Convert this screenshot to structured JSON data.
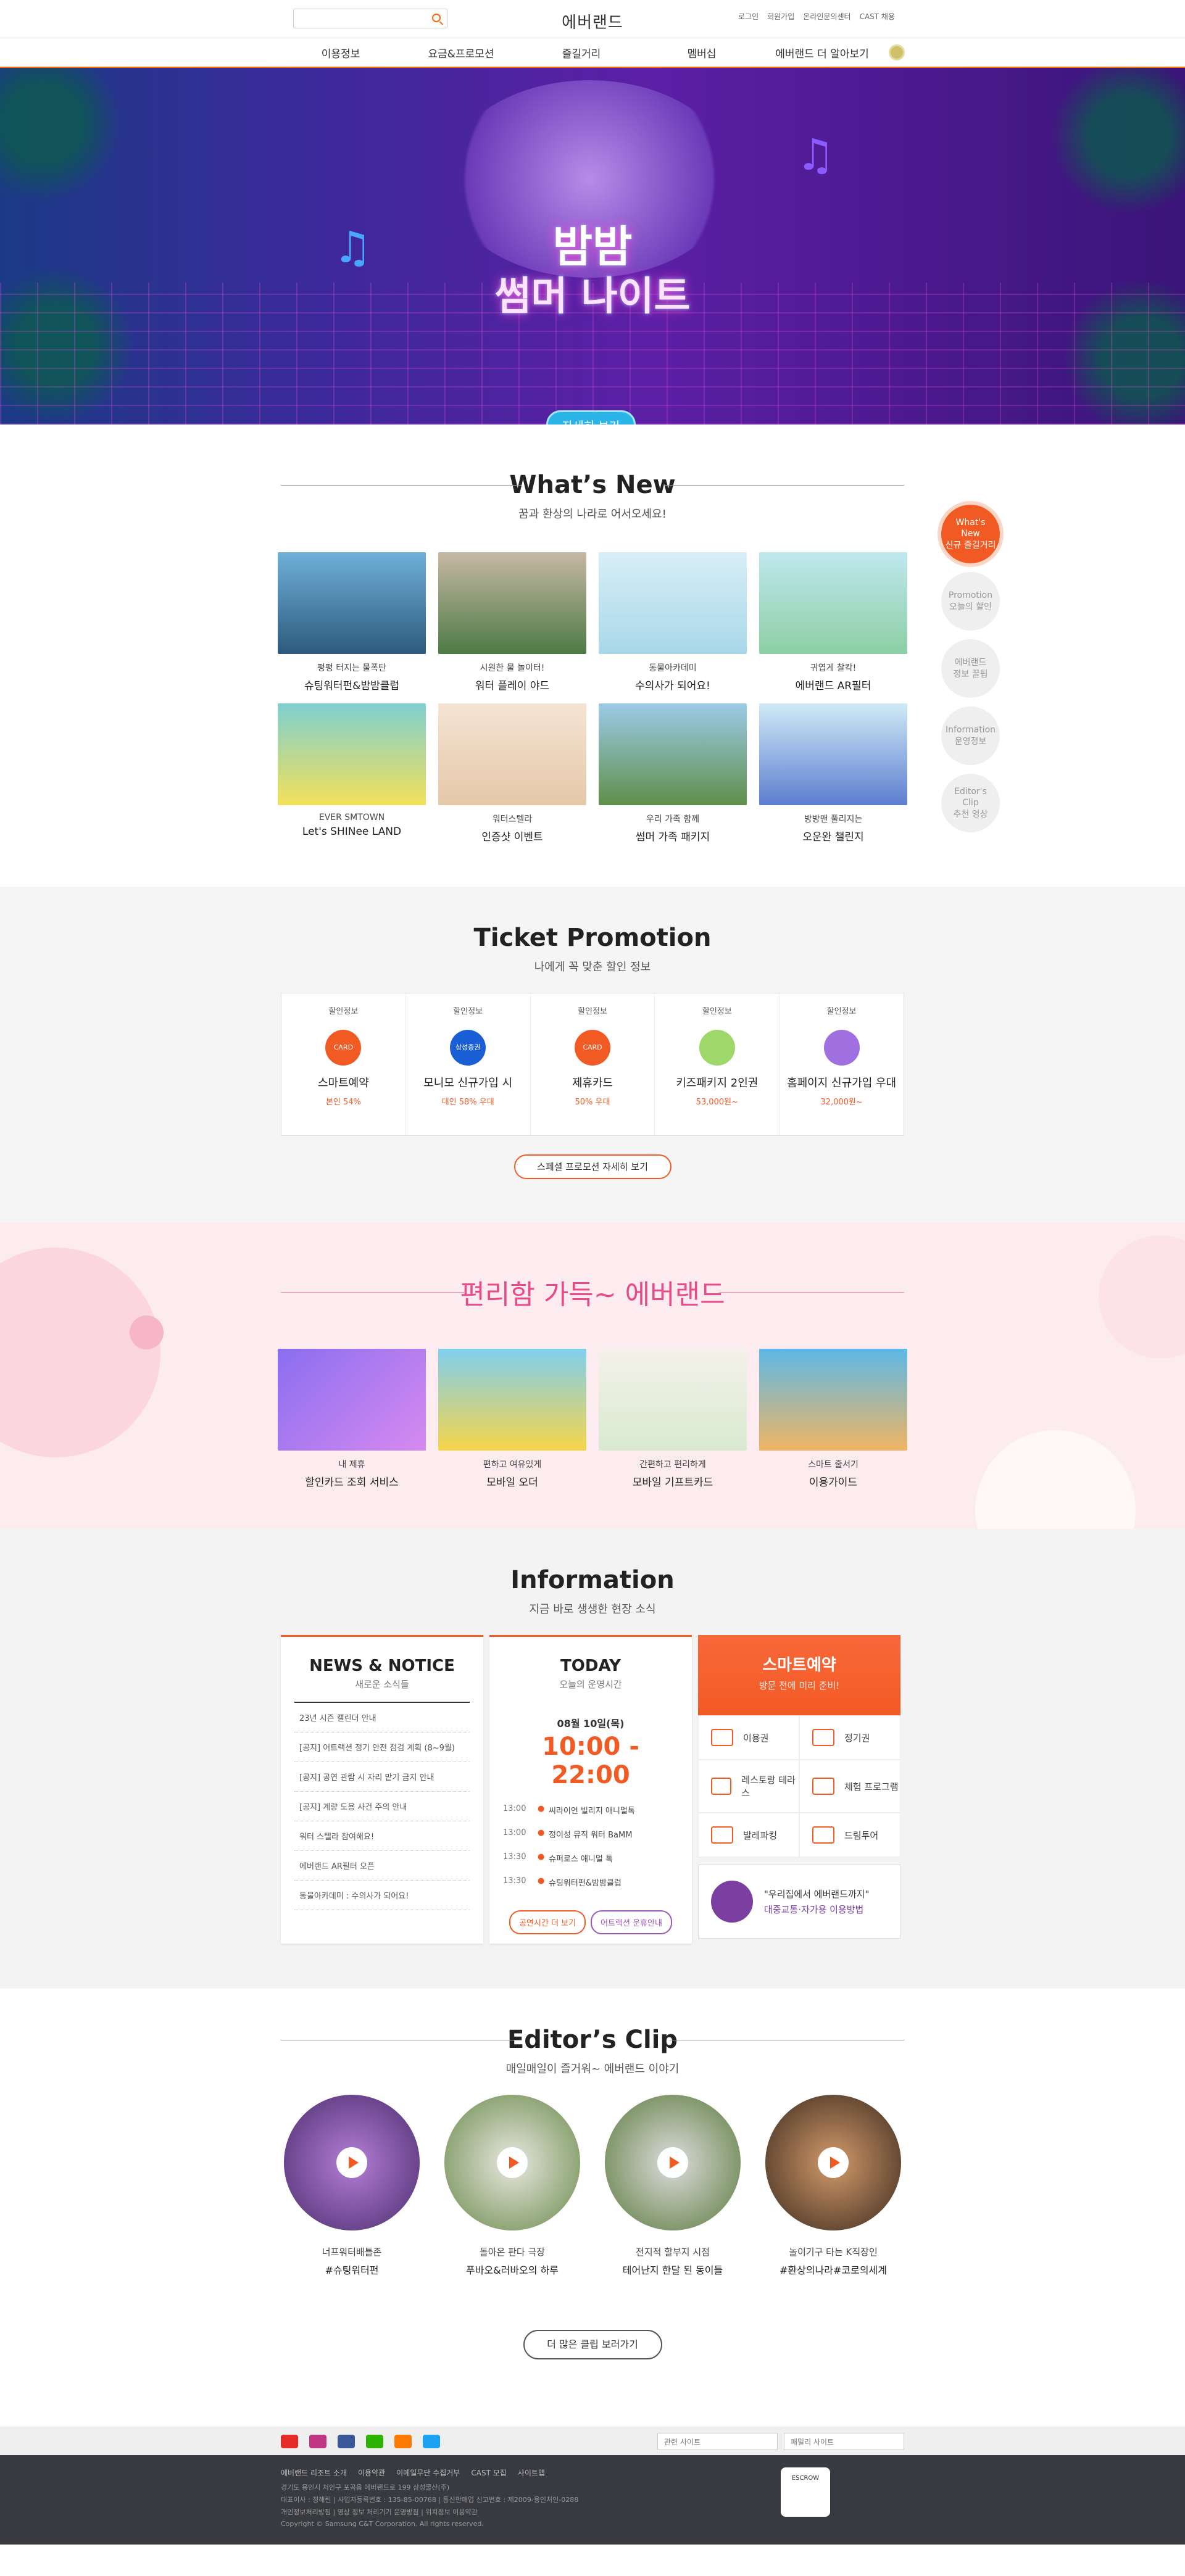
{
  "header": {
    "logo": "에버랜드",
    "search_placeholder": "",
    "links": [
      "로그인",
      "회원가입",
      "온라인문의센터",
      "CAST 채용"
    ]
  },
  "gnb": [
    "이용정보",
    "요금&프로모션",
    "즐길거리",
    "멤버십",
    "에버랜드 더 알아보기"
  ],
  "hero": {
    "title": "밤밤",
    "subtitle": "썸머 나이트",
    "button": "자세히 보기",
    "dots": 7,
    "active_dot": 6
  },
  "whatsnew": {
    "title": "What’s New",
    "sub": "꿈과 환상의 나라로 어서오세요!",
    "cards": [
      {
        "c1": "펑펑 터지는 물폭탄",
        "c2": "슈팅워터펀&밤밤클럽"
      },
      {
        "c1": "시원한 물 놀이터!",
        "c2": "워터 플레이 야드"
      },
      {
        "c1": "동물아카데미",
        "c2": "수의사가 되어요!"
      },
      {
        "c1": "귀엽게 찰칵!",
        "c2": "에버랜드 AR필터"
      },
      {
        "c1": "EVER SMTOWN",
        "c2": "Let's SHINee LAND"
      },
      {
        "c1": "워터스텔라",
        "c2": "인증샷 이벤트"
      },
      {
        "c1": "우리 가족 함께",
        "c2": "썸머 가족 패키지"
      },
      {
        "c1": "방방맨 풀리지는",
        "c2": "오운완 챌린지"
      }
    ]
  },
  "side": [
    {
      "l1": "What's",
      "l2": "New",
      "l3": "신규 즐길거리"
    },
    {
      "l1": "Promotion",
      "l2": "오늘의 할인",
      "l3": ""
    },
    {
      "l1": "에버랜드",
      "l2": "정보 꿀팁",
      "l3": ""
    },
    {
      "l1": "Information",
      "l2": "운영정보",
      "l3": ""
    },
    {
      "l1": "Editor's",
      "l2": "Clip",
      "l3": "추천 영상"
    }
  ],
  "ticket": {
    "title": "Ticket Promotion",
    "sub": "나에게 꼭 맞춘 할인 정보",
    "label": "할인정보",
    "items": [
      {
        "icon": "CARD",
        "name": "스마트예약",
        "price": "본인 54%"
      },
      {
        "icon": "삼성증권",
        "name": "모니모 신규가입 시",
        "price": "대인 58% 우대"
      },
      {
        "icon": "CARD",
        "name": "제휴카드",
        "price": "50% 우대"
      },
      {
        "icon": "",
        "name": "키즈패키지 2인권",
        "price": "53,000원~"
      },
      {
        "icon": "",
        "name": "홈페이지 신규가입 우대",
        "price": "32,000원~"
      }
    ],
    "button": "스페셜 프로모션 자세히 보기"
  },
  "conv": {
    "title": "편리함 가득~ 에버랜드",
    "cards": [
      {
        "c1": "내 제휴",
        "c2": "할인카드 조회 서비스"
      },
      {
        "c1": "편하고 여유있게",
        "c2": "모바일 오더"
      },
      {
        "c1": "간편하고 편리하게",
        "c2": "모바일 기프트카드"
      },
      {
        "c1": "스마트 줄서기",
        "c2": "이용가이드"
      }
    ]
  },
  "info": {
    "title": "Information",
    "sub": "지금 바로 생생한 현장 소식",
    "news": {
      "title": "NEWS & NOTICE",
      "sub": "새로운 소식들",
      "items": [
        "23년 시즌 캘린더 안내",
        "[공지] 어트랙션 정기 안전 점검 계획 (8~9월)",
        "[공지] 공연 관람 시 자리 맡기 금지 안내",
        "[공지] 계량 도용 사건 주의 안내",
        "워터 스텔라 참여해요!",
        "에버랜드 AR필터 오픈",
        "동물아카데미 : 수의사가 되어요!"
      ]
    },
    "today": {
      "title": "TODAY",
      "sub": "오늘의 운영시간",
      "date": "08월 10일(목)",
      "time": "10:00 - 22:00",
      "schedule": [
        {
          "t": "13:00",
          "d": "씨라이언 빌리지 애니멀톡"
        },
        {
          "t": "13:00",
          "d": "정이성 뮤직 워터 BaMM"
        },
        {
          "t": "13:30",
          "d": "슈퍼로스 애니멀 톡"
        },
        {
          "t": "13:30",
          "d": "슈팅워터펀&밤밤클럽"
        }
      ],
      "btn1": "공연시간 더 보기",
      "btn2": "어트랙션 운휴안내"
    },
    "smart": {
      "title": "스마트예약",
      "sub": "방문 전에 미리 준비!",
      "items": [
        "이용권",
        "정기권",
        "레스토랑 테라스",
        "체험 프로그램",
        "발레파킹",
        "드림투어"
      ]
    },
    "banner": {
      "l1": "\"우리집에서 에버랜드까지\"",
      "l2": "대중교통·자가용 이용방법"
    }
  },
  "editor": {
    "title": "Editor’s Clip",
    "sub": "매일매일이 즐거워~ 에버랜드 이야기",
    "clips": [
      {
        "e1": "너프워터배틀존",
        "e2": "#슈팅워터펀"
      },
      {
        "e1": "돌아온 판다 극장",
        "e2": "푸바오&러바오의 하루"
      },
      {
        "e1": "전지적 할부지 시점",
        "e2": "테어난지 한달 된 동이들"
      },
      {
        "e1": "놀이기구 타는 K직장인",
        "e2": "#환상의나라#코로의세계"
      }
    ],
    "button": "더 많은 클립 보러가기"
  },
  "footer": {
    "family": "패밀리 사이트",
    "related": "관련 사이트",
    "links": [
      "에버랜드 리조트 소개",
      "이용약관",
      "이메일무단 수집거부",
      "CAST 모집",
      "사이트맵"
    ],
    "lines": [
      "경기도 용인시 처인구 포곡읍 에버랜드로 199 삼성물산(주)",
      "대표이사 : 정해린 | 사업자등록번호 : 135-85-00768 | 통신판매업 신고번호 : 제2009-용인처인-0288",
      "개인정보처리방침 | 영상 정보 처리기기 운영방침 | 위치정보 이용약관",
      "Copyright © Samsung C&T Corporation. All rights reserved."
    ],
    "escrow": "ESCROW"
  }
}
